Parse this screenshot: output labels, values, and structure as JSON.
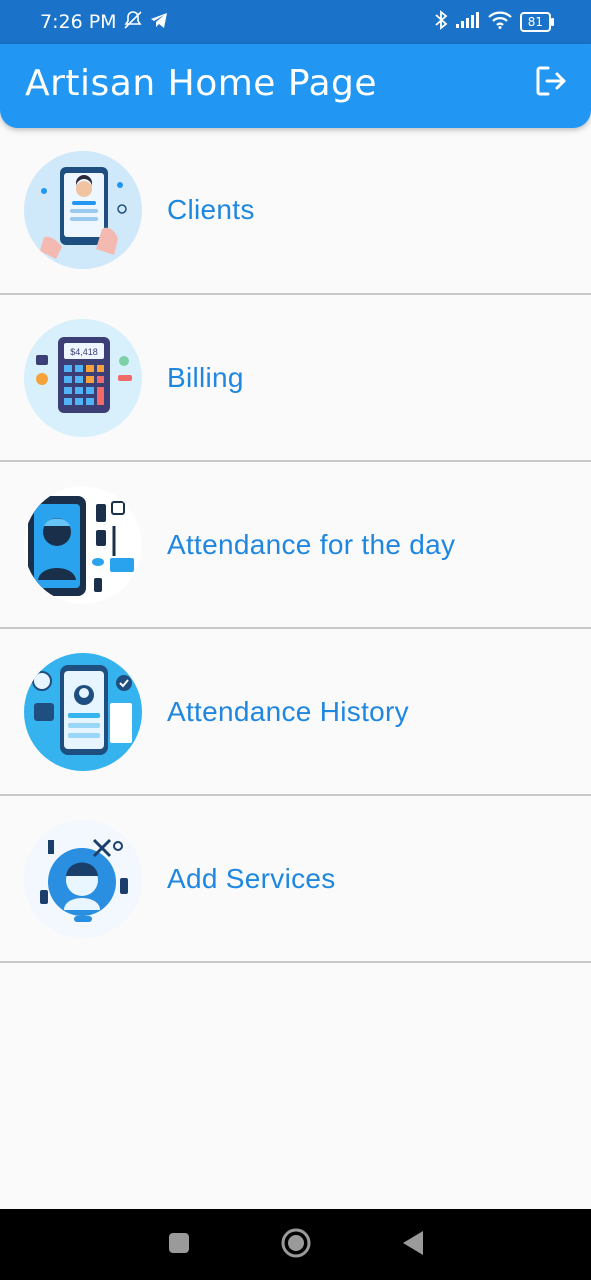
{
  "status_bar": {
    "time": "7:26 PM",
    "battery": "81",
    "icons": [
      "mute-icon",
      "telegram-icon",
      "bluetooth-icon",
      "signal-icon",
      "wifi-icon",
      "battery-icon"
    ]
  },
  "app_bar": {
    "title": "Artisan Home Page",
    "logout_icon": "logout-icon",
    "color": "#2196f3"
  },
  "menu": {
    "items": [
      {
        "label": "Clients",
        "icon": "clients-illustration"
      },
      {
        "label": "Billing",
        "icon": "billing-illustration",
        "amount_text": "$4,418"
      },
      {
        "label": "Attendance for the day",
        "icon": "attendance-day-illustration"
      },
      {
        "label": "Attendance History",
        "icon": "attendance-history-illustration"
      },
      {
        "label": "Add Services",
        "icon": "add-services-illustration"
      }
    ],
    "label_color": "#1f87e0"
  },
  "nav_bar": {
    "icons": [
      "recents-icon",
      "home-icon",
      "back-icon"
    ]
  }
}
